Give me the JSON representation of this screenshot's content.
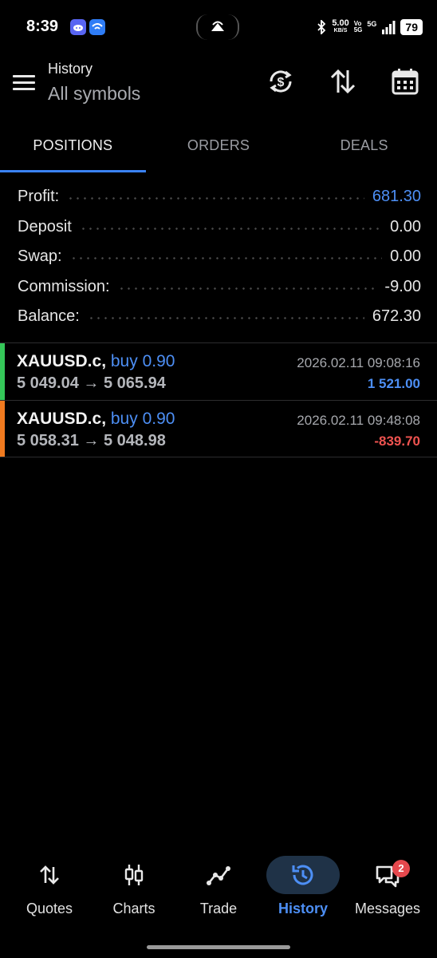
{
  "status_bar": {
    "time": "8:39",
    "speed_value": "5.00",
    "speed_unit": "KB/S",
    "net_vo": "Vo",
    "net_5g_small": "5G",
    "net_5g": "5G",
    "battery": "79"
  },
  "header": {
    "title": "History",
    "subtitle": "All symbols",
    "icons": [
      "currency-cycle-icon",
      "sort-arrows-icon",
      "calendar-icon"
    ]
  },
  "tabs": [
    {
      "label": "POSITIONS",
      "active": true
    },
    {
      "label": "ORDERS",
      "active": false
    },
    {
      "label": "DEALS",
      "active": false
    }
  ],
  "summary": [
    {
      "label": "Profit:",
      "value": "681.30"
    },
    {
      "label": "Deposit",
      "value": "0.00"
    },
    {
      "label": "Swap:",
      "value": "0.00"
    },
    {
      "label": "Commission:",
      "value": "-9.00"
    },
    {
      "label": "Balance:",
      "value": "672.30"
    }
  ],
  "positions": [
    {
      "symbol": "XAUUSD.c,",
      "side": "buy 0.90",
      "open_price": "5 049.04",
      "arrow": "→",
      "close_price": "5 065.94",
      "time": "2026.02.11 09:08:16",
      "profit": "1 521.00",
      "bar_color": "#35c759",
      "profit_color": "#4d8ff5"
    },
    {
      "symbol": "XAUUSD.c,",
      "side": "buy 0.90",
      "open_price": "5 058.31",
      "arrow": "→",
      "close_price": "5 048.98",
      "time": "2026.02.11 09:48:08",
      "profit": "-839.70",
      "bar_color": "#f07a1f",
      "profit_color": "#ef5350"
    }
  ],
  "bottom_nav": [
    {
      "label": "Quotes",
      "icon": "swap-arrows-icon",
      "active": false
    },
    {
      "label": "Charts",
      "icon": "candlestick-icon",
      "active": false
    },
    {
      "label": "Trade",
      "icon": "trend-line-icon",
      "active": false
    },
    {
      "label": "History",
      "icon": "history-clock-icon",
      "active": true
    },
    {
      "label": "Messages",
      "icon": "chat-icon",
      "active": false,
      "badge": "2"
    }
  ],
  "colors": {
    "accent": "#4d8ff5",
    "background": "#000000",
    "profit_positive": "#4d8ff5",
    "profit_negative": "#ef5350"
  }
}
